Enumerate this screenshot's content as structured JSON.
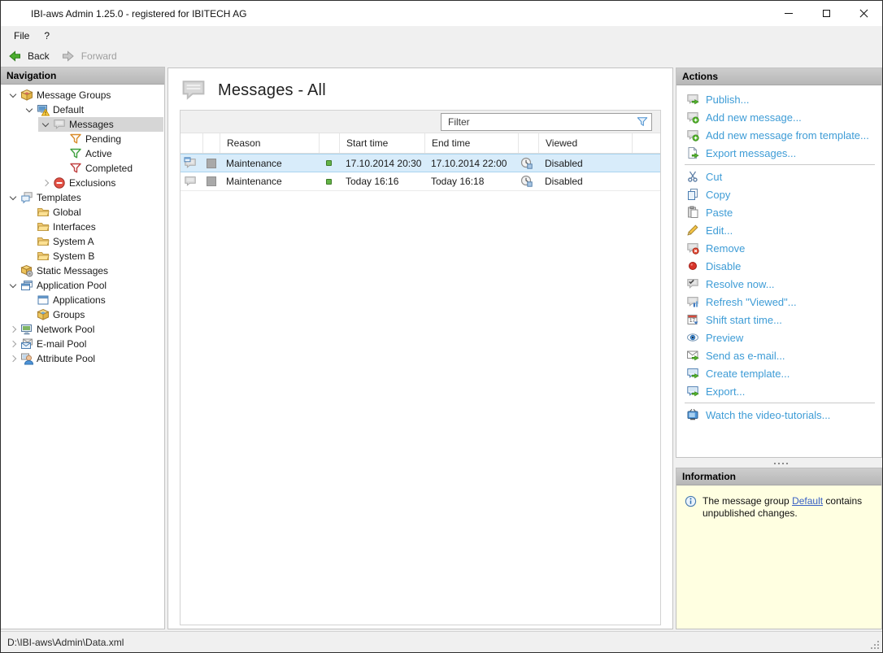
{
  "colors": {
    "accent_link": "#3E9CD6",
    "info_bg": "#FFFFE1",
    "selection_row": "#D8ECFA",
    "tree_selection": "#D6D6D6",
    "status_green": "#63B346",
    "disabled_red": "#D8342A"
  },
  "window": {
    "title": "IBI-aws Admin 1.25.0 - registered for IBITECH AG"
  },
  "menu": {
    "items": [
      {
        "label": "File"
      },
      {
        "label": "?"
      }
    ]
  },
  "toolbar": {
    "back_label": "Back",
    "forward_label": "Forward"
  },
  "navigation": {
    "header": "Navigation",
    "tree": [
      {
        "label": "Message Groups",
        "icon": "message-groups",
        "level": 0,
        "expander": "expanded"
      },
      {
        "label": "Default",
        "icon": "default-group",
        "level": 1,
        "expander": "expanded"
      },
      {
        "label": "Messages",
        "icon": "messages",
        "level": 2,
        "expander": "expanded",
        "selected": true
      },
      {
        "label": "Pending",
        "icon": "funnel-orange",
        "level": 3
      },
      {
        "label": "Active",
        "icon": "funnel-green",
        "level": 3
      },
      {
        "label": "Completed",
        "icon": "funnel-red",
        "level": 3
      },
      {
        "label": "Exclusions",
        "icon": "exclusions",
        "level": 2,
        "expander": "collapsed"
      },
      {
        "label": "Templates",
        "icon": "templates",
        "level": 0,
        "expander": "expanded"
      },
      {
        "label": "Global",
        "icon": "folder",
        "level": 1
      },
      {
        "label": "Interfaces",
        "icon": "folder",
        "level": 1
      },
      {
        "label": "System A",
        "icon": "folder",
        "level": 1
      },
      {
        "label": "System B",
        "icon": "folder",
        "level": 1
      },
      {
        "label": "Static Messages",
        "icon": "static-messages",
        "level": 0
      },
      {
        "label": "Application Pool",
        "icon": "application-pool",
        "level": 0,
        "expander": "expanded"
      },
      {
        "label": "Applications",
        "icon": "applications",
        "level": 1
      },
      {
        "label": "Groups",
        "icon": "groups",
        "level": 1
      },
      {
        "label": "Network Pool",
        "icon": "network-pool",
        "level": 0,
        "expander": "collapsed"
      },
      {
        "label": "E-mail Pool",
        "icon": "email-pool",
        "level": 0,
        "expander": "collapsed"
      },
      {
        "label": "Attribute Pool",
        "icon": "attribute-pool",
        "level": 0,
        "expander": "collapsed"
      }
    ]
  },
  "main": {
    "title": "Messages - All",
    "filter_placeholder": "Filter",
    "table": {
      "columns": [
        {
          "key": "msg_icon",
          "label": ""
        },
        {
          "key": "swatch",
          "label": ""
        },
        {
          "key": "reason",
          "label": "Reason"
        },
        {
          "key": "status",
          "label": ""
        },
        {
          "key": "start",
          "label": "Start time"
        },
        {
          "key": "end",
          "label": "End time"
        },
        {
          "key": "viewed_icon",
          "label": ""
        },
        {
          "key": "viewed",
          "label": "Viewed"
        }
      ],
      "rows": [
        {
          "icon": "message-displayed",
          "reason": "Maintenance",
          "status": "green",
          "start": "17.10.2014 20:30",
          "end": "17.10.2014 22:00",
          "viewed": "Disabled",
          "selected": true
        },
        {
          "icon": "message-plain",
          "reason": "Maintenance",
          "status": "green",
          "start": "Today 16:16",
          "end": "Today 16:18",
          "viewed": "Disabled",
          "selected": false
        }
      ]
    }
  },
  "actions": {
    "header": "Actions",
    "groups": [
      [
        {
          "label": "Publish...",
          "icon": "publish"
        },
        {
          "label": "Add new message...",
          "icon": "add-message"
        },
        {
          "label": "Add new message from template...",
          "icon": "add-message"
        },
        {
          "label": "Export messages...",
          "icon": "export-doc"
        }
      ],
      [
        {
          "label": "Cut",
          "icon": "cut"
        },
        {
          "label": "Copy",
          "icon": "copy"
        },
        {
          "label": "Paste",
          "icon": "paste"
        },
        {
          "label": "Edit...",
          "icon": "edit"
        },
        {
          "label": "Remove",
          "icon": "remove"
        },
        {
          "label": "Disable",
          "icon": "disable"
        },
        {
          "label": "Resolve now...",
          "icon": "resolve"
        },
        {
          "label": "Refresh \"Viewed\"...",
          "icon": "refresh-viewed"
        },
        {
          "label": "Shift start time...",
          "icon": "shift-time"
        },
        {
          "label": "Preview",
          "icon": "preview"
        },
        {
          "label": "Send as e-mail...",
          "icon": "send-email"
        },
        {
          "label": "Create template...",
          "icon": "create-template"
        },
        {
          "label": "Export...",
          "icon": "export-msg"
        }
      ],
      [
        {
          "label": "Watch the video-tutorials...",
          "icon": "tv"
        }
      ]
    ]
  },
  "information": {
    "header": "Information",
    "text_before": "The message group ",
    "link": "Default",
    "text_after": " contains unpublished changes."
  },
  "statusbar": {
    "path": "D:\\IBI-aws\\Admin\\Data.xml"
  }
}
